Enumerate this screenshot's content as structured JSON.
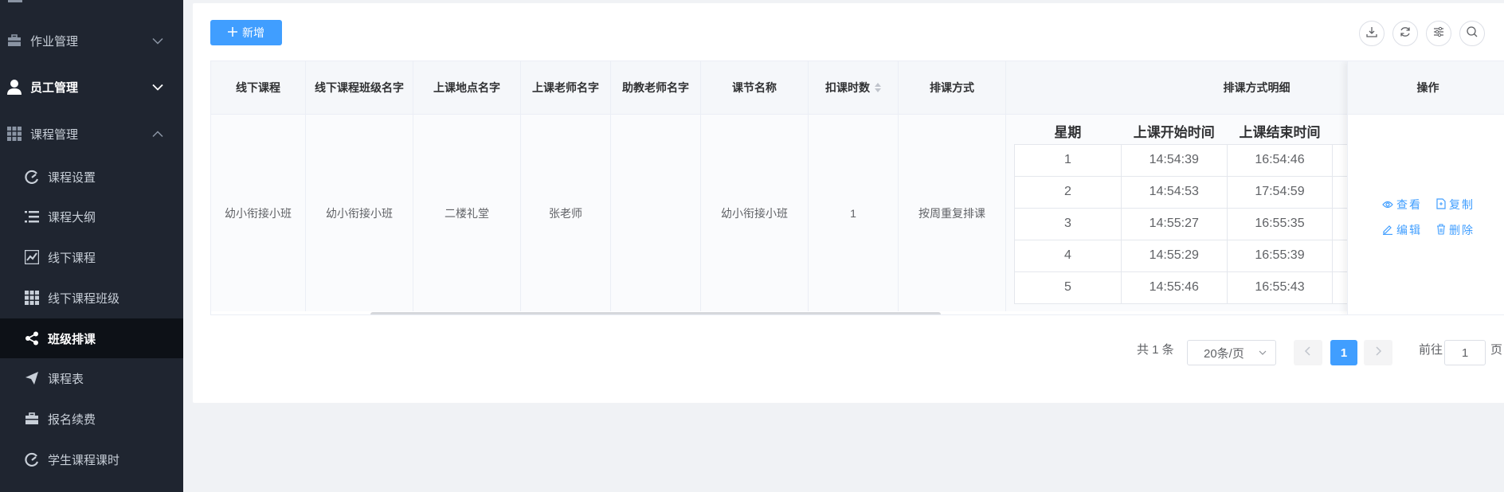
{
  "sidebar": {
    "items": [
      {
        "label": "作业管理",
        "icon": "briefcase-icon"
      },
      {
        "label": "员工管理",
        "icon": "user-icon"
      },
      {
        "label": "课程管理",
        "icon": "grid-icon"
      },
      {
        "label": "课程设置",
        "icon": "gauge-icon"
      },
      {
        "label": "课程大纲",
        "icon": "list-icon"
      },
      {
        "label": "线下课程",
        "icon": "chart-line-icon"
      },
      {
        "label": "线下课程班级",
        "icon": "grid-icon"
      },
      {
        "label": "班级排课",
        "icon": "share-icon"
      },
      {
        "label": "课程表",
        "icon": "send-icon"
      },
      {
        "label": "报名续费",
        "icon": "briefcase-icon"
      },
      {
        "label": "学生课程课时",
        "icon": "gauge-icon"
      }
    ]
  },
  "toolbar": {
    "add_label": "新增",
    "tools": [
      "download-icon",
      "refresh-icon",
      "filter-icon",
      "search-icon"
    ]
  },
  "table": {
    "headers": [
      "线下课程",
      "线下课程班级名字",
      "上课地点名字",
      "上课老师名字",
      "助教老师名字",
      "课节名称",
      "扣课时数",
      "排课方式",
      "排课方式明细",
      "操作"
    ],
    "row": [
      "幼小衔接小班",
      "幼小衔接小班",
      "二楼礼堂",
      "张老师",
      "",
      "幼小衔接小班",
      "1",
      "按周重复排课"
    ],
    "detail_headers": [
      "星期",
      "上课开始时间",
      "上课结束时间"
    ],
    "detail_rows": [
      [
        "1",
        "14:54:39",
        "16:54:46"
      ],
      [
        "2",
        "14:54:53",
        "17:54:59"
      ],
      [
        "3",
        "14:55:27",
        "16:55:35"
      ],
      [
        "4",
        "14:55:29",
        "16:55:39"
      ],
      [
        "5",
        "14:55:46",
        "16:55:43"
      ]
    ],
    "actions": {
      "view": "查看",
      "copy": "复制",
      "edit": "编辑",
      "delete": "删除"
    }
  },
  "pagination": {
    "total": "共 1 条",
    "page_size": "20条/页",
    "current_page": "1",
    "goto_label": "前往",
    "goto_value": "1",
    "page_suffix": "页"
  },
  "colors": {
    "primary": "#409eff",
    "sidebar_bg": "#1f2530",
    "active_bg": "#0d1117"
  }
}
